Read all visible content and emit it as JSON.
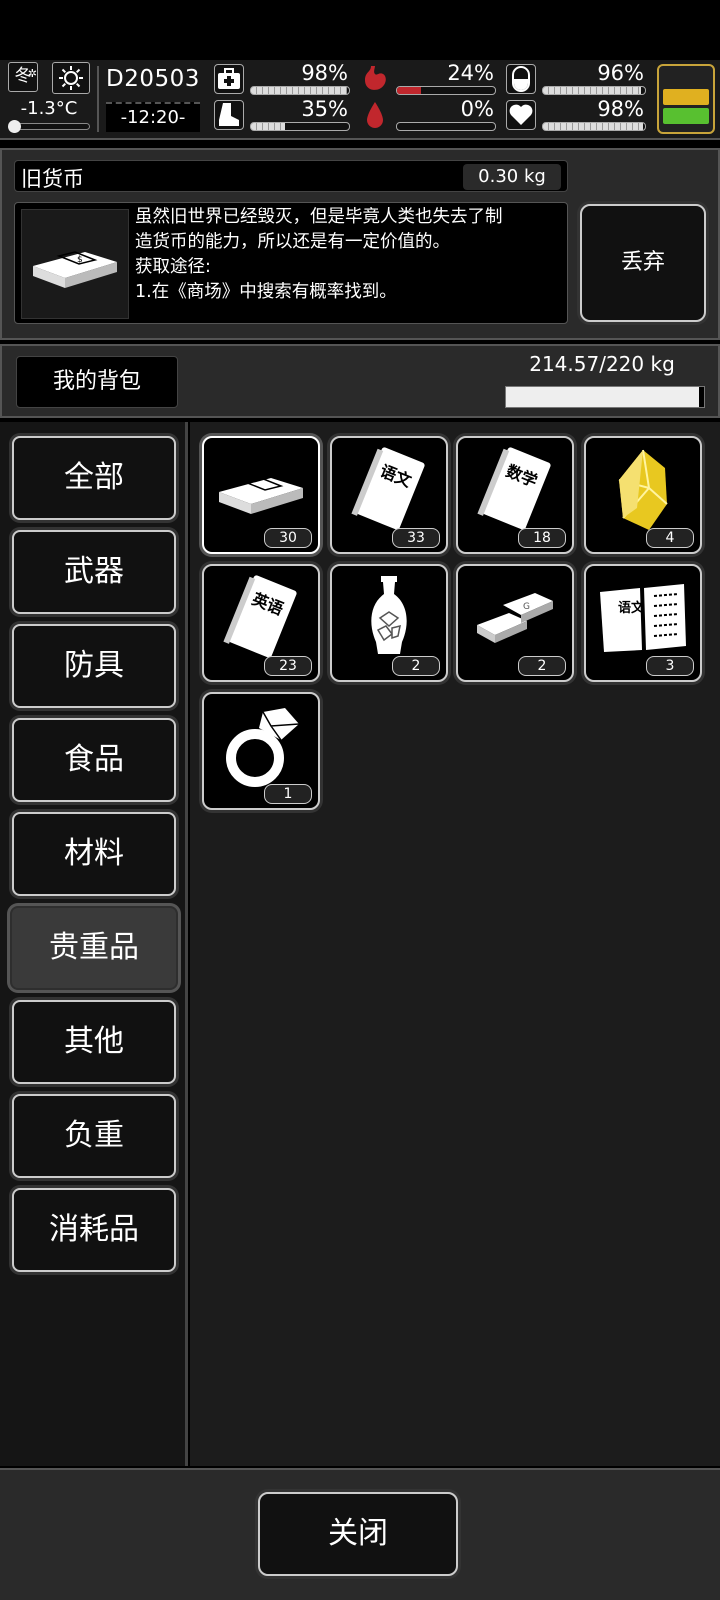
{
  "status": {
    "season": "冬",
    "temperature": "-1.3°C",
    "day": "D20503",
    "time": "-12:20-",
    "stats": [
      {
        "name": "health",
        "value": "98%",
        "level": 0.98
      },
      {
        "name": "hunger",
        "value": "24%",
        "level": 0.24
      },
      {
        "name": "hydration",
        "value": "96%",
        "level": 0.96
      },
      {
        "name": "stamina",
        "value": "35%",
        "level": 0.35
      },
      {
        "name": "bleeding",
        "value": "0%",
        "level": 0.0
      },
      {
        "name": "mood",
        "value": "98%",
        "level": 0.98
      }
    ],
    "battery_colors": [
      "#222222",
      "#e0b020",
      "#58c030"
    ]
  },
  "detail": {
    "name": "旧货币",
    "weight": "0.30 kg",
    "description": "虽然旧世界已经毁灭，但是毕竟人类也失去了制\n造货币的能力，所以还是有一定价值的。\n获取途径:\n1.在《商场》中搜索有概率找到。",
    "discard_label": "丢弃"
  },
  "bag": {
    "title": "我的背包",
    "weight": "214.57/220 kg",
    "load_fraction": 0.975
  },
  "categories": [
    "全部",
    "武器",
    "防具",
    "食品",
    "材料",
    "贵重品",
    "其他",
    "负重",
    "消耗品"
  ],
  "active_category": "贵重品",
  "items": [
    {
      "icon": "cash-bundle-icon",
      "count": "30",
      "selected": true
    },
    {
      "icon": "chinese-book-icon",
      "count": "33",
      "label": "语文"
    },
    {
      "icon": "math-book-icon",
      "count": "18",
      "label": "数学"
    },
    {
      "icon": "gold-crystal-icon",
      "count": "4"
    },
    {
      "icon": "english-book-icon",
      "count": "23",
      "label": "英语"
    },
    {
      "icon": "vase-icon",
      "count": "2"
    },
    {
      "icon": "gold-bars-icon",
      "count": "2"
    },
    {
      "icon": "open-book-icon",
      "count": "3",
      "label": "语文"
    },
    {
      "icon": "diamond-ring-icon",
      "count": "1"
    }
  ],
  "close_label": "关闭"
}
